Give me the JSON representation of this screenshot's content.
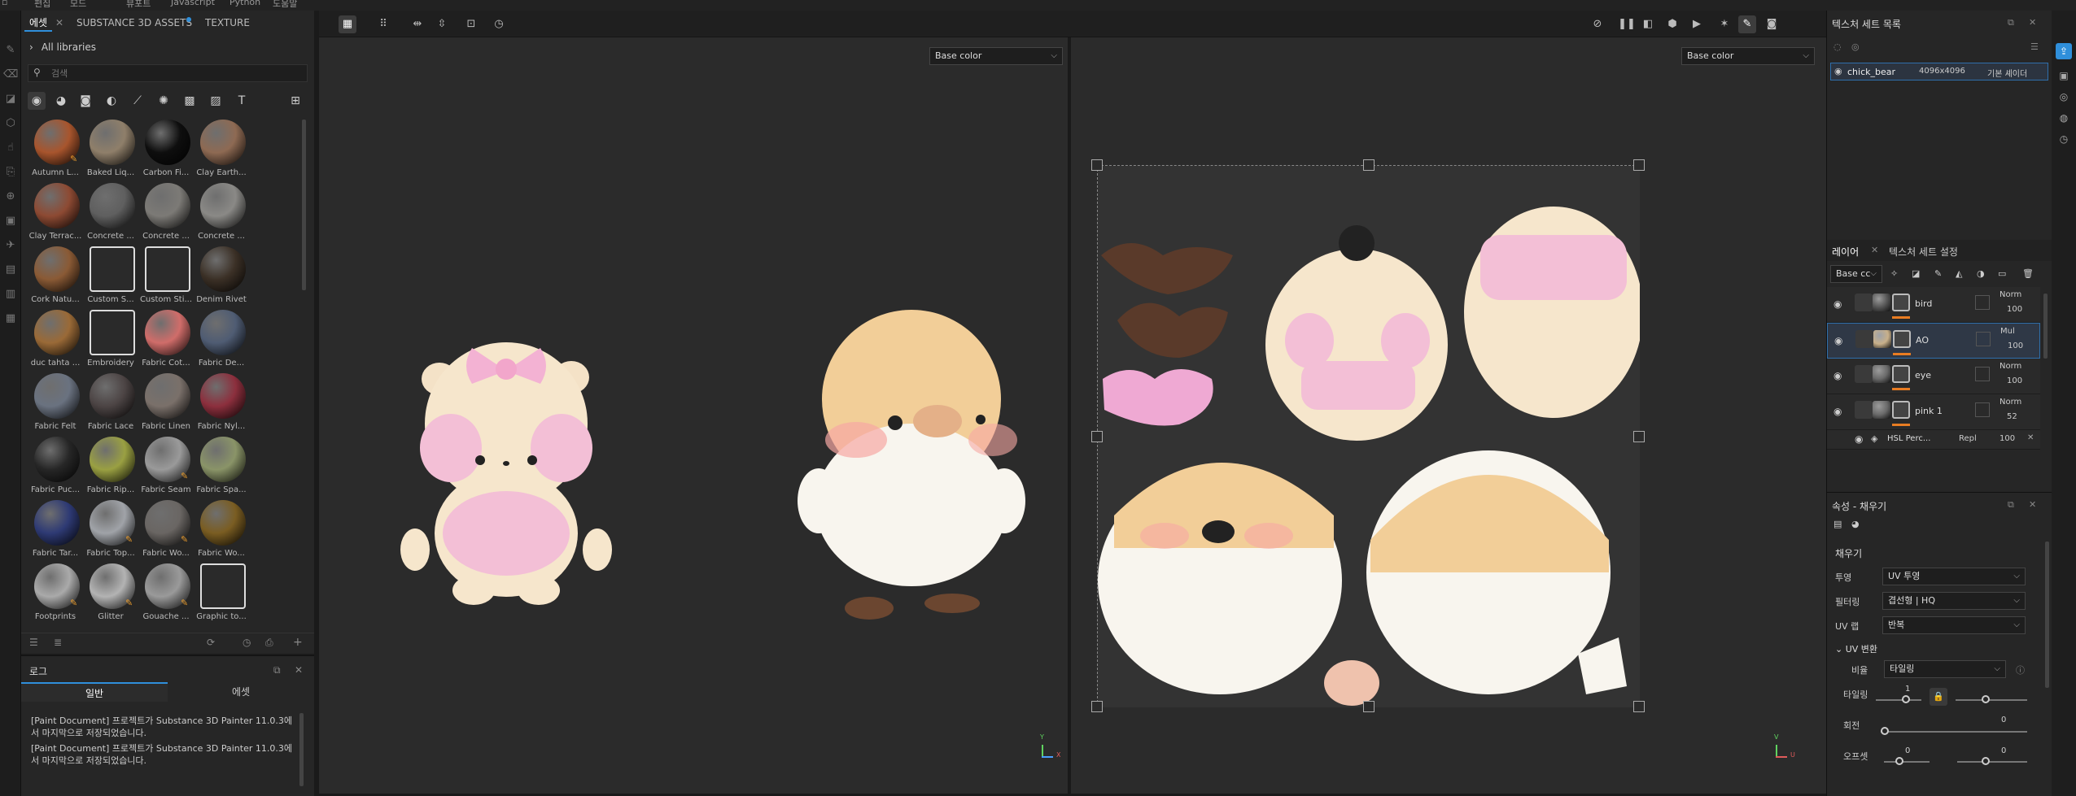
{
  "menu": [
    "편집",
    "모드",
    "뷰포트",
    "Javascript",
    "Python",
    "도움말"
  ],
  "assets": {
    "tabs": [
      "에셋",
      "SUBSTANCE 3D ASSETS",
      "TEXTURE"
    ],
    "libraries_label": "All libraries",
    "search_placeholder": "검색",
    "items": [
      {
        "label": "Autumn L...",
        "color": "#a8552d",
        "star": true
      },
      {
        "label": "Baked Liq...",
        "color": "#8f7f6a",
        "star": false
      },
      {
        "label": "Carbon Fi...",
        "color": "#0e0e0e",
        "star": false
      },
      {
        "label": "Clay Earth...",
        "color": "#8e6a53",
        "star": false
      },
      {
        "label": "Clay Terrac...",
        "color": "#8d4a33",
        "star": false
      },
      {
        "label": "Concrete ...",
        "color": "#5f5f5f",
        "star": false
      },
      {
        "label": "Concrete ...",
        "color": "#7c7a76",
        "star": false
      },
      {
        "label": "Concrete ...",
        "color": "#8a8986",
        "star": false
      },
      {
        "label": "Cork Natu...",
        "color": "#8a5a35",
        "star": false
      },
      {
        "label": "Custom S...",
        "color": "#555555",
        "star": false,
        "square": true
      },
      {
        "label": "Custom Sti...",
        "color": "#555555",
        "star": false,
        "square": true
      },
      {
        "label": "Denim Rivet",
        "color": "#3b3026",
        "star": false
      },
      {
        "label": "duc tahta ...",
        "color": "#9a6a37",
        "star": false
      },
      {
        "label": "Embroidery",
        "color": "#555555",
        "star": false,
        "square": true
      },
      {
        "label": "Fabric Cot...",
        "color": "#d06d6a",
        "star": false
      },
      {
        "label": "Fabric De...",
        "color": "#4f5c73",
        "star": false
      },
      {
        "label": "Fabric Felt",
        "color": "#6a7280",
        "star": false
      },
      {
        "label": "Fabric Lace",
        "color": "#4c4444",
        "star": false
      },
      {
        "label": "Fabric Linen",
        "color": "#7a706a",
        "star": false
      },
      {
        "label": "Fabric Nyl...",
        "color": "#8c2f3d",
        "star": false
      },
      {
        "label": "Fabric Puc...",
        "color": "#262626",
        "star": false
      },
      {
        "label": "Fabric Rip...",
        "color": "#9aa042",
        "star": false
      },
      {
        "label": "Fabric Seam",
        "color": "#9a9a9a",
        "star": true
      },
      {
        "label": "Fabric Spa...",
        "color": "#8a9468",
        "star": false
      },
      {
        "label": "Fabric Tar...",
        "color": "#2e3a74",
        "star": false
      },
      {
        "label": "Fabric Top...",
        "color": "#a0a3a8",
        "star": true
      },
      {
        "label": "Fabric Wo...",
        "color": "#6a6663",
        "star": true
      },
      {
        "label": "Fabric Wo...",
        "color": "#7a5d22",
        "star": false
      },
      {
        "label": "Footprints",
        "color": "#aaaaaa",
        "star": true
      },
      {
        "label": "Glitter",
        "color": "#b3b3b3",
        "star": true
      },
      {
        "label": "Gouache ...",
        "color": "#9a9a9a",
        "star": true
      },
      {
        "label": "Graphic to...",
        "color": "#555555",
        "star": false,
        "square": true
      }
    ]
  },
  "log": {
    "title": "로그",
    "tabs": [
      "일반",
      "에셋"
    ],
    "lines": [
      "[Paint Document] 프로젝트가 Substance 3D Painter 11.0.3에서 마지막으로 저장되었습니다.",
      "[Paint Document] 프로젝트가 Substance 3D Painter 11.0.3에서 마지막으로 저장되었습니다."
    ]
  },
  "viewport": {
    "left_channel": "Base color",
    "right_channel": "Base color",
    "axis_y": "Y",
    "axis_x": "X",
    "axis_v": "V",
    "axis_u": "U"
  },
  "texture_sets": {
    "title": "텍스처 세트 목록",
    "row_name": "chick_bear",
    "row_size": "4096x4096",
    "row_shader": "기본 셰이더"
  },
  "layers": {
    "tabs": [
      "레이어",
      "텍스처 세트 설정"
    ],
    "channel": "Base cc",
    "items": [
      {
        "name": "bird",
        "blend": "Norm",
        "opacity": "100",
        "thumb": "#555555",
        "selected": false
      },
      {
        "name": "AO",
        "blend": "Mul",
        "opacity": "100",
        "thumb": "#c8b08a",
        "selected": true
      },
      {
        "name": "eye",
        "blend": "Norm",
        "opacity": "100",
        "thumb": "#6a6a6a",
        "selected": false
      },
      {
        "name": "pink 1",
        "blend": "Norm",
        "opacity": "52",
        "thumb": "#6a6a6a",
        "selected": false
      }
    ],
    "effect_name": "HSL Perc...",
    "effect_blend": "Repl",
    "effect_opacity": "100"
  },
  "properties": {
    "title": "속성 - 채우기",
    "section": "채우기",
    "projection_label": "투영",
    "projection_value": "UV 투영",
    "filter_label": "필터링",
    "filter_value": "겹선형 | HQ",
    "uvwrap_label": "UV 랩",
    "uvwrap_value": "반복",
    "uvtransform_label": "UV 변환",
    "scale_label": "비율",
    "scale_value": "타일링",
    "tiling_label": "타일링",
    "tiling_value": "1",
    "rotation_label": "회전",
    "rotation_value": "0",
    "offset_label": "오프셋",
    "offset_value_1": "0",
    "offset_value_2": "0"
  },
  "colors": {
    "accent": "#2f8fdb",
    "layer_bar": "#e87c22"
  }
}
